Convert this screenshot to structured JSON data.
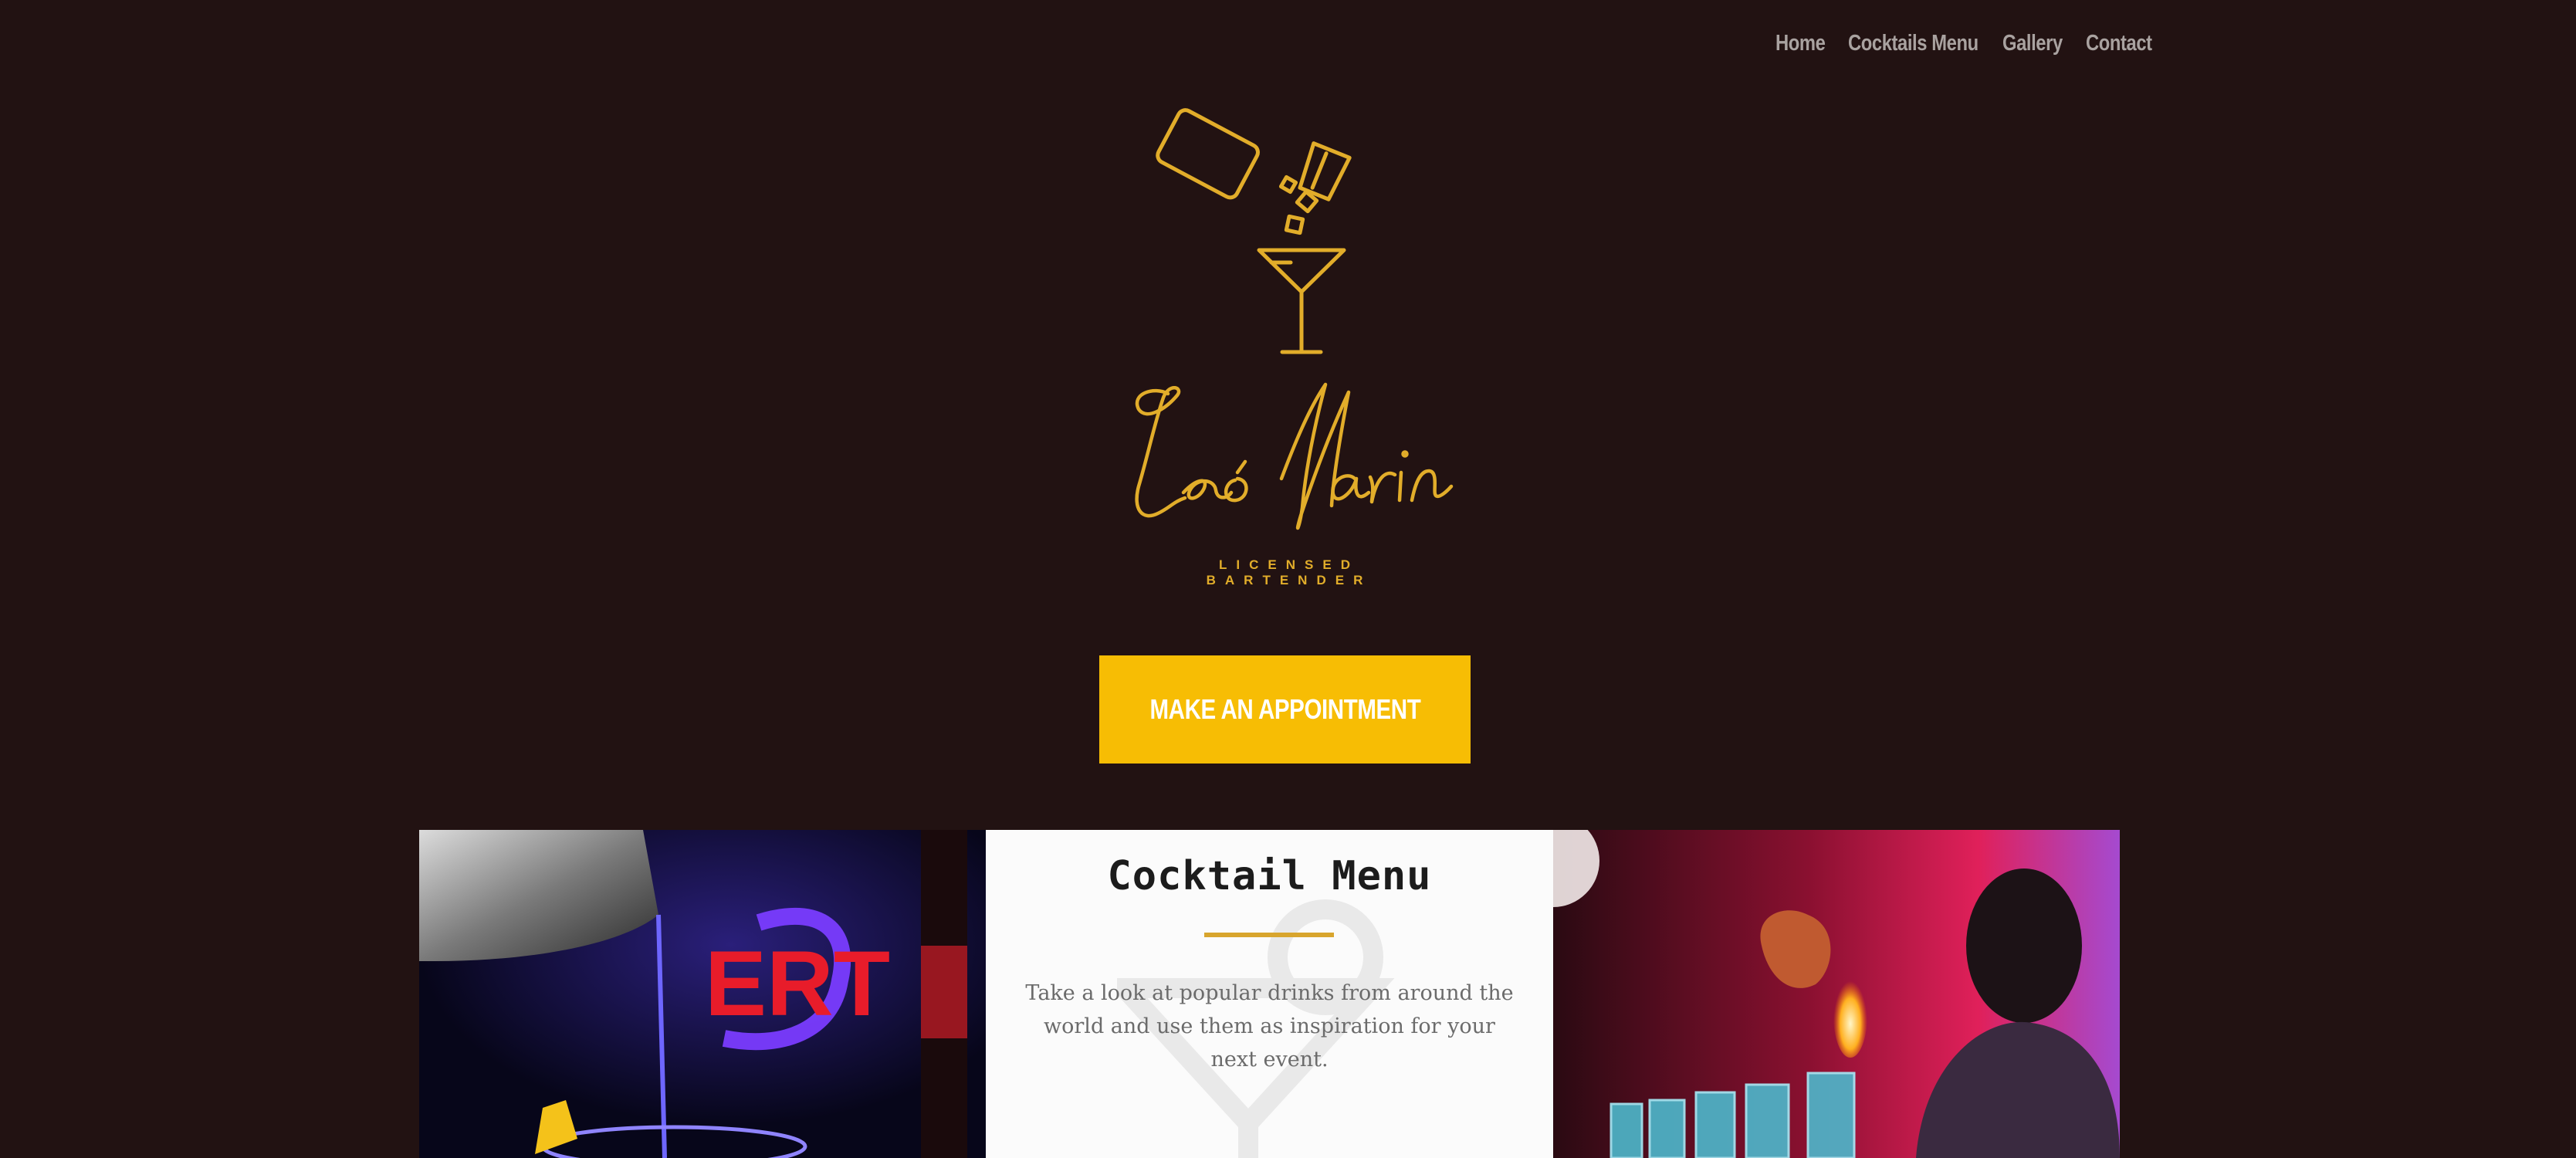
{
  "nav": {
    "items": [
      {
        "label": "Home"
      },
      {
        "label": "Cocktails Menu"
      },
      {
        "label": "Gallery"
      },
      {
        "label": "Contact"
      }
    ]
  },
  "logo": {
    "name": "Leo Marin",
    "tagline": "LICENSED BARTENDER"
  },
  "cta": {
    "label": "MAKE AN APPOINTMENT"
  },
  "panels": {
    "middle": {
      "title": "Cocktail Menu",
      "description": "Take a look at popular drinks from around the world and use them as inspiration for your next event."
    }
  },
  "colors": {
    "background": "#221212",
    "accent": "#f7bd04",
    "logo_gold": "#e2ad2a",
    "nav_text": "#a9a2a0"
  }
}
